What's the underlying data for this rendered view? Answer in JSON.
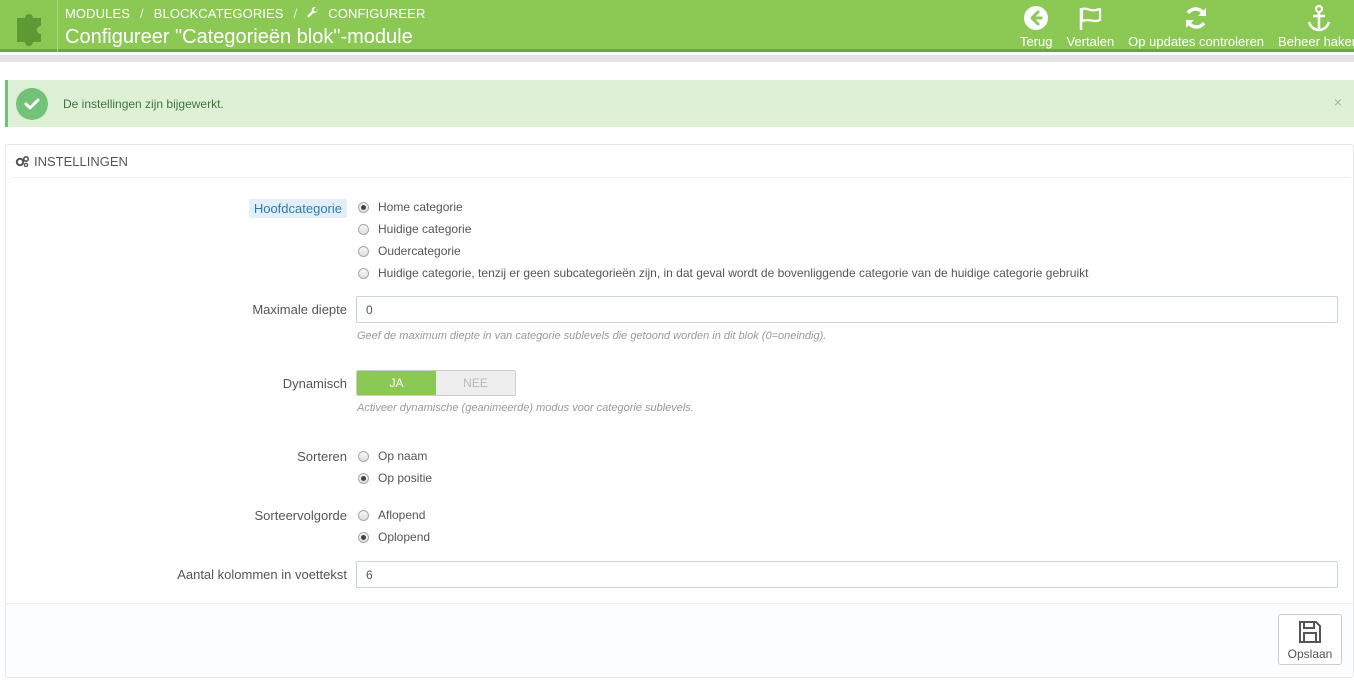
{
  "header": {
    "breadcrumb": [
      "MODULES",
      "BLOCKCATEGORIES",
      "CONFIGUREER"
    ],
    "title": "Configureer \"Categorieën blok\"-module",
    "toolbar": [
      {
        "label": "Terug",
        "icon": "back-arrow-icon"
      },
      {
        "label": "Vertalen",
        "icon": "flag-icon"
      },
      {
        "label": "Op updates controleren",
        "icon": "refresh-icon"
      },
      {
        "label": "Beheer haken",
        "icon": "anchor-icon"
      }
    ],
    "color": "#8bc954"
  },
  "alert": {
    "message": "De instellingen zijn bijgewerkt.",
    "close": "×"
  },
  "panel": {
    "heading": "INSTELLINGEN",
    "fields": {
      "hoofdcategorie": {
        "label": "Hoofdcategorie",
        "options": [
          "Home categorie",
          "Huidige categorie",
          "Oudercategorie",
          "Huidige categorie, tenzij er geen subcategorieën zijn, in dat geval wordt de bovenliggende categorie van de huidige categorie gebruikt"
        ],
        "selected": 0
      },
      "diepte": {
        "label": "Maximale diepte",
        "value": "0",
        "help": "Geef de maximum diepte in van categorie sublevels die getoond worden in dit blok (0=oneindig)."
      },
      "dynamisch": {
        "label": "Dynamisch",
        "yes": "JA",
        "no": "NEE",
        "help": "Activeer dynamische (geanimeerde) modus voor categorie sublevels."
      },
      "sorteren": {
        "label": "Sorteren",
        "options": [
          "Op naam",
          "Op positie"
        ],
        "selected": 1
      },
      "volgorde": {
        "label": "Sorteervolgorde",
        "options": [
          "Aflopend",
          "Oplopend"
        ],
        "selected": 1
      },
      "kolommen": {
        "label": "Aantal kolommen in voettekst",
        "value": "6"
      }
    },
    "save": "Opslaan"
  }
}
